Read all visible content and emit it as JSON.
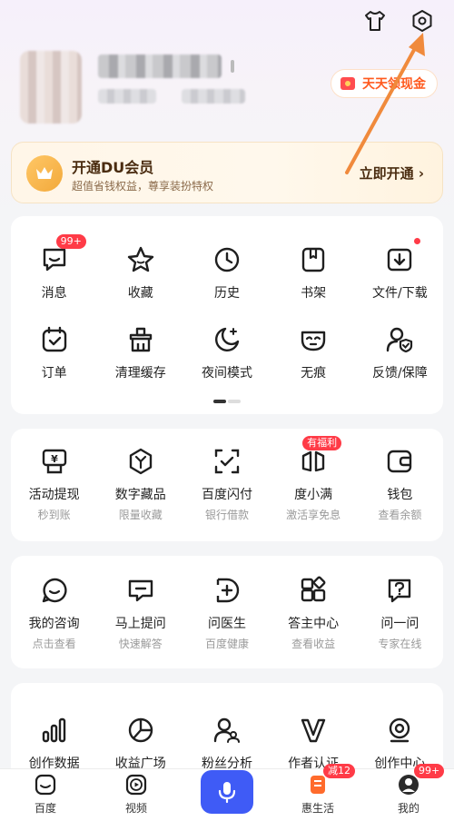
{
  "header": {
    "shirt_icon": "tshirt-icon",
    "settings_icon": "settings-icon",
    "cash_button_label": "天天领现金"
  },
  "vip": {
    "title": "开通DU会员",
    "subtitle": "超值省钱权益，尊享装扮特权",
    "button_label": "立即开通 ›"
  },
  "quick_tools": {
    "row1": [
      {
        "label": "消息",
        "icon": "message-icon",
        "badge": "99+"
      },
      {
        "label": "收藏",
        "icon": "star-icon"
      },
      {
        "label": "历史",
        "icon": "clock-icon"
      },
      {
        "label": "书架",
        "icon": "bookmark-icon"
      },
      {
        "label": "文件/下载",
        "icon": "download-icon",
        "dot": true
      }
    ],
    "row2": [
      {
        "label": "订单",
        "icon": "order-icon"
      },
      {
        "label": "清理缓存",
        "icon": "broom-icon"
      },
      {
        "label": "夜间模式",
        "icon": "moon-icon"
      },
      {
        "label": "无痕",
        "icon": "mask-icon"
      },
      {
        "label": "反馈/保障",
        "icon": "shield-user-icon"
      }
    ]
  },
  "services": [
    {
      "label": "活动提现",
      "sub": "秒到账",
      "icon": "yuan-wallet-icon"
    },
    {
      "label": "数字藏品",
      "sub": "限量收藏",
      "icon": "hexagon-icon"
    },
    {
      "label": "百度闪付",
      "sub": "银行借款",
      "icon": "scan-check-icon"
    },
    {
      "label": "度小满",
      "sub": "激活享免息",
      "icon": "duxiaoman-icon",
      "badge": "有福利"
    },
    {
      "label": "钱包",
      "sub": "查看余额",
      "icon": "wallet-icon"
    }
  ],
  "qa": [
    {
      "label": "我的咨询",
      "sub": "点击查看",
      "icon": "chat-smile-icon"
    },
    {
      "label": "马上提问",
      "sub": "快速解答",
      "icon": "chat-minus-icon"
    },
    {
      "label": "问医生",
      "sub": "百度健康",
      "icon": "doctor-icon"
    },
    {
      "label": "答主中心",
      "sub": "查看收益",
      "icon": "apps-icon"
    },
    {
      "label": "问一问",
      "sub": "专家在线",
      "icon": "question-icon"
    }
  ],
  "creator": [
    {
      "label": "创作数据",
      "icon": "bar-chart-icon"
    },
    {
      "label": "收益广场",
      "icon": "pie-chart-icon"
    },
    {
      "label": "粉丝分析",
      "icon": "fans-icon"
    },
    {
      "label": "作者认证",
      "icon": "v-badge-icon"
    },
    {
      "label": "创作中心",
      "icon": "creator-icon"
    }
  ],
  "tabbar": [
    {
      "label": "百度",
      "icon": "baidu-home-icon"
    },
    {
      "label": "视频",
      "icon": "video-play-icon"
    },
    {
      "label": "",
      "icon": "microphone-icon"
    },
    {
      "label": "惠生活",
      "icon": "life-icon",
      "badge": "减12"
    },
    {
      "label": "我的",
      "icon": "profile-icon",
      "badge": "99+"
    }
  ],
  "colors": {
    "accent": "#3f5bf6",
    "badge": "#ff3b47",
    "vip_text": "#4a2c10",
    "annotation_arrow": "#f08a3c"
  }
}
